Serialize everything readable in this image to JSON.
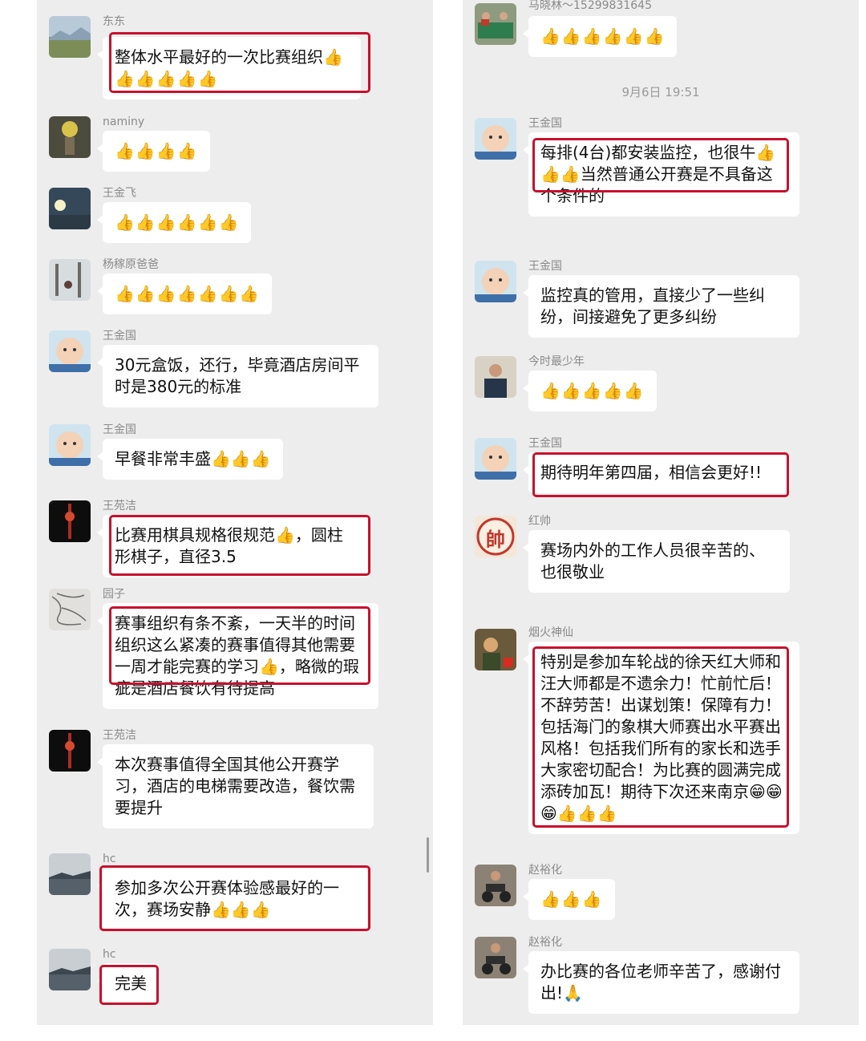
{
  "thumbs": "👍",
  "grin": "😁",
  "pray": "🙏",
  "left": [
    {
      "sender": "东东",
      "text": "整体水平最好的一次比赛组织👍",
      "tail": "👍👍👍👍👍"
    },
    {
      "sender": "naminy",
      "text": "",
      "tail": "👍👍👍👍"
    },
    {
      "sender": "王金飞",
      "text": "",
      "tail": "👍👍👍👍👍👍"
    },
    {
      "sender": "杨稼原爸爸",
      "text": "",
      "tail": "👍👍👍👍👍👍👍"
    },
    {
      "sender": "王金国",
      "text": "30元盒饭，还行，毕竟酒店房间平时是380元的标准",
      "tail": ""
    },
    {
      "sender": "王金国",
      "text": "早餐非常丰盛👍👍👍",
      "tail": ""
    },
    {
      "sender": "王苑洁",
      "text": "比赛用棋具规格很规范👍，圆柱形棋子，直径3.5",
      "tail": ""
    },
    {
      "sender": "园子",
      "text": "赛事组织有条不紊，一天半的时间组织这么紧凑的赛事值得其他需要一周才能完赛的学习👍，略微的瑕疵是酒店餐饮有待提高",
      "tail": ""
    },
    {
      "sender": "王苑洁",
      "text": "本次赛事值得全国其他公开赛学习，酒店的电梯需要改造，餐饮需要提升",
      "tail": ""
    },
    {
      "sender": "hc",
      "text": "参加多次公开赛体验感最好的一次，赛场安静👍👍👍",
      "tail": ""
    },
    {
      "sender": "hc",
      "text": "完美",
      "tail": ""
    }
  ],
  "right": [
    {
      "sender": "马晓林～15299831645",
      "text": "",
      "tail": "👍👍👍👍👍👍"
    },
    {
      "sender": "王金国",
      "text": "每排(4台)都安装监控，也很牛👍👍👍当然普通公开赛是不具备这个条件的",
      "tail": ""
    },
    {
      "sender": "王金国",
      "text": "监控真的管用，直接少了一些纠纷，间接避免了更多纠纷",
      "tail": ""
    },
    {
      "sender": "今时最少年",
      "text": "",
      "tail": "👍👍👍👍👍"
    },
    {
      "sender": "王金国",
      "text": "期待明年第四届，相信会更好!!",
      "tail": ""
    },
    {
      "sender": "红帅",
      "text": "赛场内外的工作人员很辛苦的、也很敬业",
      "tail": ""
    },
    {
      "sender": "烟火神仙",
      "text": "特别是参加车轮战的徐天红大师和汪大师都是不遗余力！忙前忙后！不辞劳苦！出谋划策！保障有力！包括海门的象棋大师赛出水平赛出风格！包括我们所有的家长和选手大家密切配合！为比赛的圆满完成添砖加瓦！期待下次还来南京😁😁😁👍👍👍",
      "tail": ""
    },
    {
      "sender": "赵裕化",
      "text": "",
      "tail": "👍👍👍"
    },
    {
      "sender": "赵裕化",
      "text": "办比赛的各位老师辛苦了，感谢付出!🙏",
      "tail": ""
    }
  ],
  "timestamp": "9月6日 19:51",
  "avatar_badge": "帥",
  "colors": {
    "panel": "#ededed",
    "bubble": "#ffffff",
    "highlight": "#c8102e",
    "name": "#8a8a8a",
    "thumbs": "#f3b23a"
  }
}
